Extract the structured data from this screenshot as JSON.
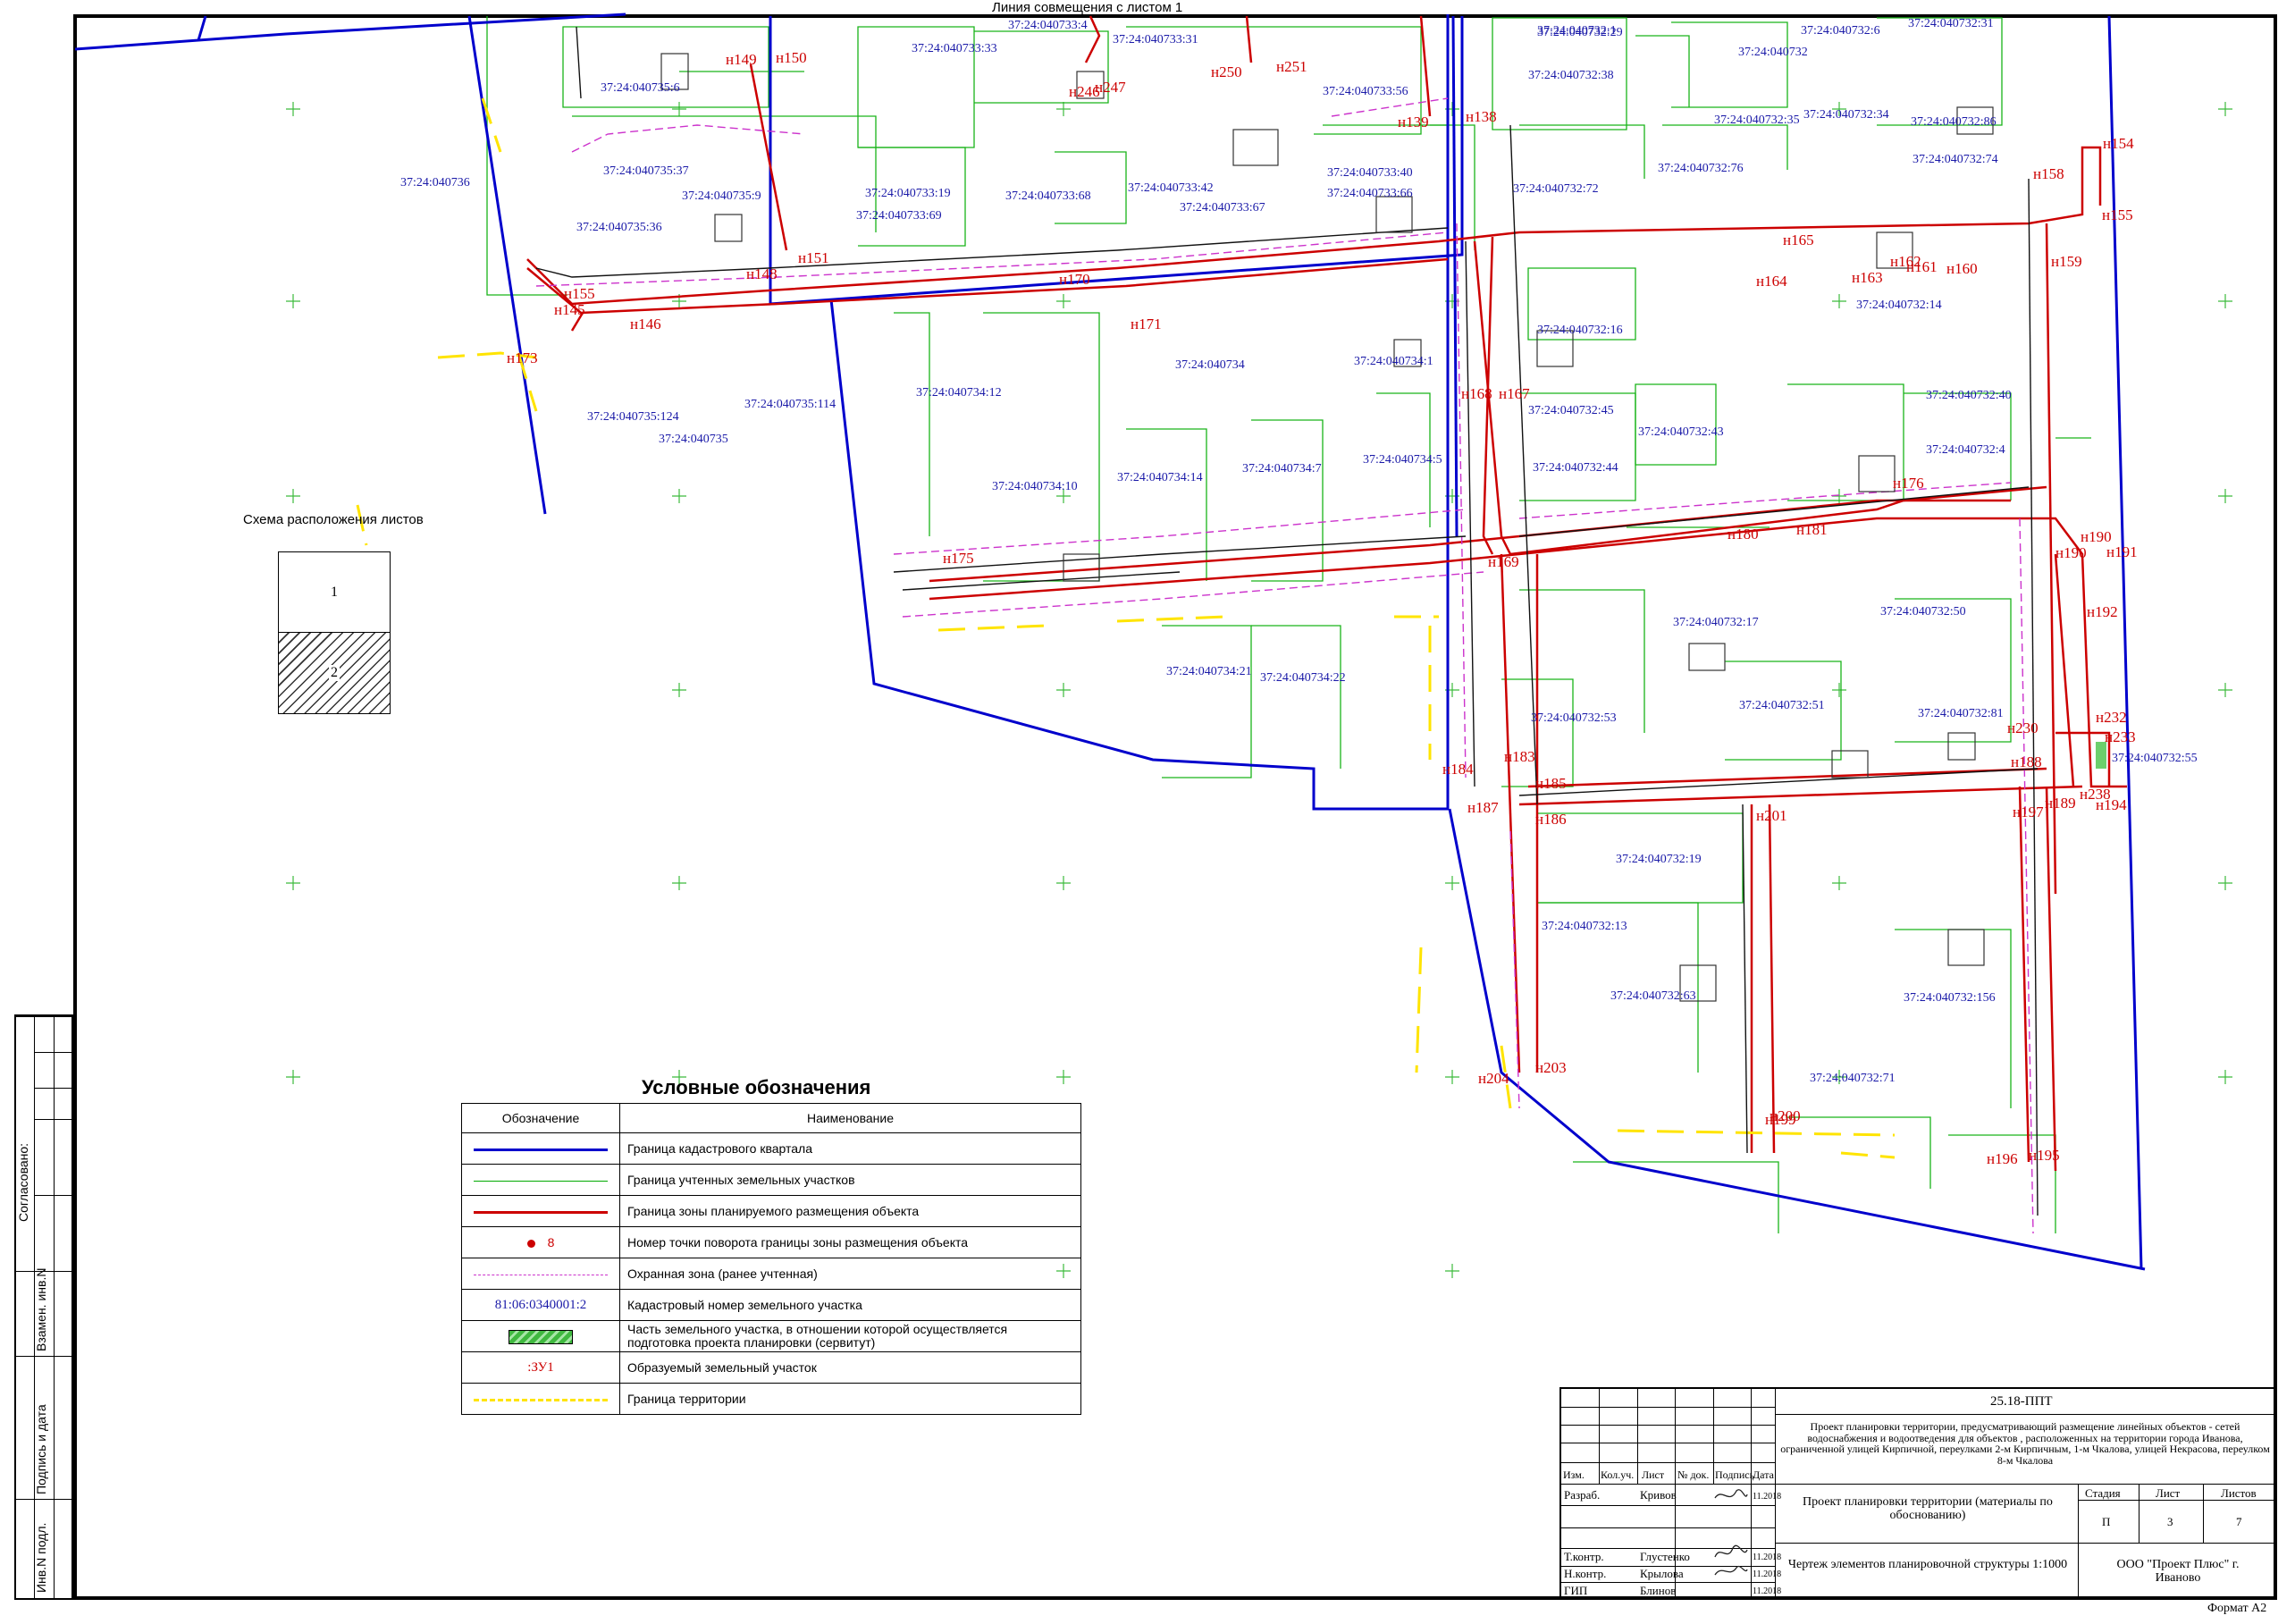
{
  "header": {
    "match_line": "Линия совмещения с листом 1"
  },
  "schema": {
    "title": "Схема расположения листов",
    "sheet1": "1",
    "sheet2": "2"
  },
  "parcel_labels": [
    "37:24:040736",
    "37:24:040735:6",
    "37:24:040735:37",
    "37:24:040735:9",
    "37:24:040735:36",
    "37:24:040733:4",
    "37:24:040733:33",
    "37:24:040733:31",
    "37:24:040733:19",
    "37:24:040733:68",
    "37:24:040733:69",
    "37:24:040733:42",
    "37:24:040733:67",
    "37:24:040733:56",
    "37:24:040733:40",
    "37:24:040733:66",
    "37:24:040732:1",
    "37:24:040732:38",
    "37:24:040732:29",
    "37:24:040732",
    "37:24:040732:6",
    "37:24:040732:31",
    "37:24:040732:35",
    "37:24:040732:34",
    "37:24:040732:86",
    "37:24:040732:76",
    "37:24:040732:72",
    "37:24:040732:74",
    "37:24:040732:14",
    "37:24:040732:16",
    "37:24:040732:45",
    "37:24:040732:43",
    "37:24:040732:40",
    "37:24:040732:44",
    "37:24:040732:4",
    "37:24:040734:12",
    "37:24:040734",
    "37:24:040734:1",
    "37:24:040734:14",
    "37:24:040734:10",
    "37:24:040734:7",
    "37:24:040734:5",
    "37:24:040735:124",
    "37:24:040735",
    "37:24:040735:114",
    "37:24:040734:21",
    "37:24:040734:22",
    "37:24:040732:50",
    "37:24:040732:17",
    "37:24:040732:53",
    "37:24:040732:51",
    "37:24:040732:81",
    "37:24:040732:55",
    "37:24:040732:19",
    "37:24:040732:13",
    "37:24:040732:63",
    "37:24:040732:156",
    "37:24:040732:71"
  ],
  "point_labels": [
    "н149",
    "н150",
    "н145",
    "н146",
    "н173",
    "н151",
    "н148",
    "н155",
    "н250",
    "н251",
    "н246",
    "н247",
    "н138",
    "н139",
    "н154",
    "н155",
    "н158",
    "н159",
    "н160",
    "н161",
    "н162",
    "н163",
    "н164",
    "н165",
    "н167",
    "н168",
    "н171",
    "н170",
    "н176",
    "н181",
    "н180",
    "н175",
    "н169",
    "н190",
    "н191",
    "н192",
    "н232",
    "н233",
    "н238",
    "н189",
    "н188",
    "н230",
    "н184",
    "н183",
    "н187",
    "н186",
    "н185",
    "н204",
    "н203",
    "н201",
    "н200",
    "н199",
    "н197",
    "н196",
    "н195",
    "н194",
    "н190"
  ],
  "legend": {
    "title": "Условные обозначения",
    "col1": "Обозначение",
    "col2": "Наименование",
    "rows": [
      {
        "text": "Граница кадастрового квартала"
      },
      {
        "text": "Граница учтенных земельных участков"
      },
      {
        "text": "Граница зоны планируемого размещения объекта"
      },
      {
        "sym": "8",
        "text": "Номер точки поворота  границы зоны размещения объекта"
      },
      {
        "text": "Охранная зона (ранее учтенная)"
      },
      {
        "sym": "81:06:0340001:2",
        "text": "Кадастровый номер земельного участка"
      },
      {
        "text": "Часть земельного участка, в отношении которой осуществляется подготовка проекта планировки (сервитут)"
      },
      {
        "sym": ":ЗУ1",
        "text": "Образуемый земельный участок"
      },
      {
        "text": "Граница территории"
      }
    ],
    "colors": {
      "kadastr": "#0000cc",
      "parcels": "#00aa00",
      "zone": "#cc0000",
      "pink": "#cc33cc",
      "yellow": "#ffee00"
    }
  },
  "title_block": {
    "code": "25.18-ППТ",
    "project": "Проект планировки территории, предусматривающий размещение линейных объектов - сетей водоснабжения и водоотведения для объектов , расположенных на территории города Иванова, ограниченной улицей Кирпичной, переулками 2-м Кирпичным, 1-м Чкалова, улицей Некрасова, переулком 8-м Чкалова",
    "headers": [
      "Изм.",
      "Кол.уч.",
      "Лист",
      "№ док.",
      "Подпись",
      "Дата"
    ],
    "roles": [
      {
        "role": "Разраб.",
        "name": "Кривов",
        "date": "11.2018"
      },
      {
        "role": "Т.контр.",
        "name": "Глустенко",
        "date": "11.2018"
      },
      {
        "role": "Н.контр.",
        "name": "Крылова",
        "date": "11.2018"
      },
      {
        "role": "ГИП",
        "name": "Блинов",
        "date": "11.2018"
      }
    ],
    "doc_title": "Проект планировки территории (материалы по обоснованию)",
    "stage_h": "Стадия",
    "sheet_h": "Лист",
    "sheets_h": "Листов",
    "stage": "П",
    "sheet": "3",
    "sheets": "7",
    "drawing": "Чертеж элементов планировочной структуры 1:1000",
    "company": "ООО \"Проект Плюс\" г. Иваново"
  },
  "side_strip": {
    "agreed": "Согласовано:",
    "replaced": "Взамен. инв.N",
    "sign": "Подпись и дата",
    "inv": "Инв.N подл."
  },
  "format": "Формат А2"
}
